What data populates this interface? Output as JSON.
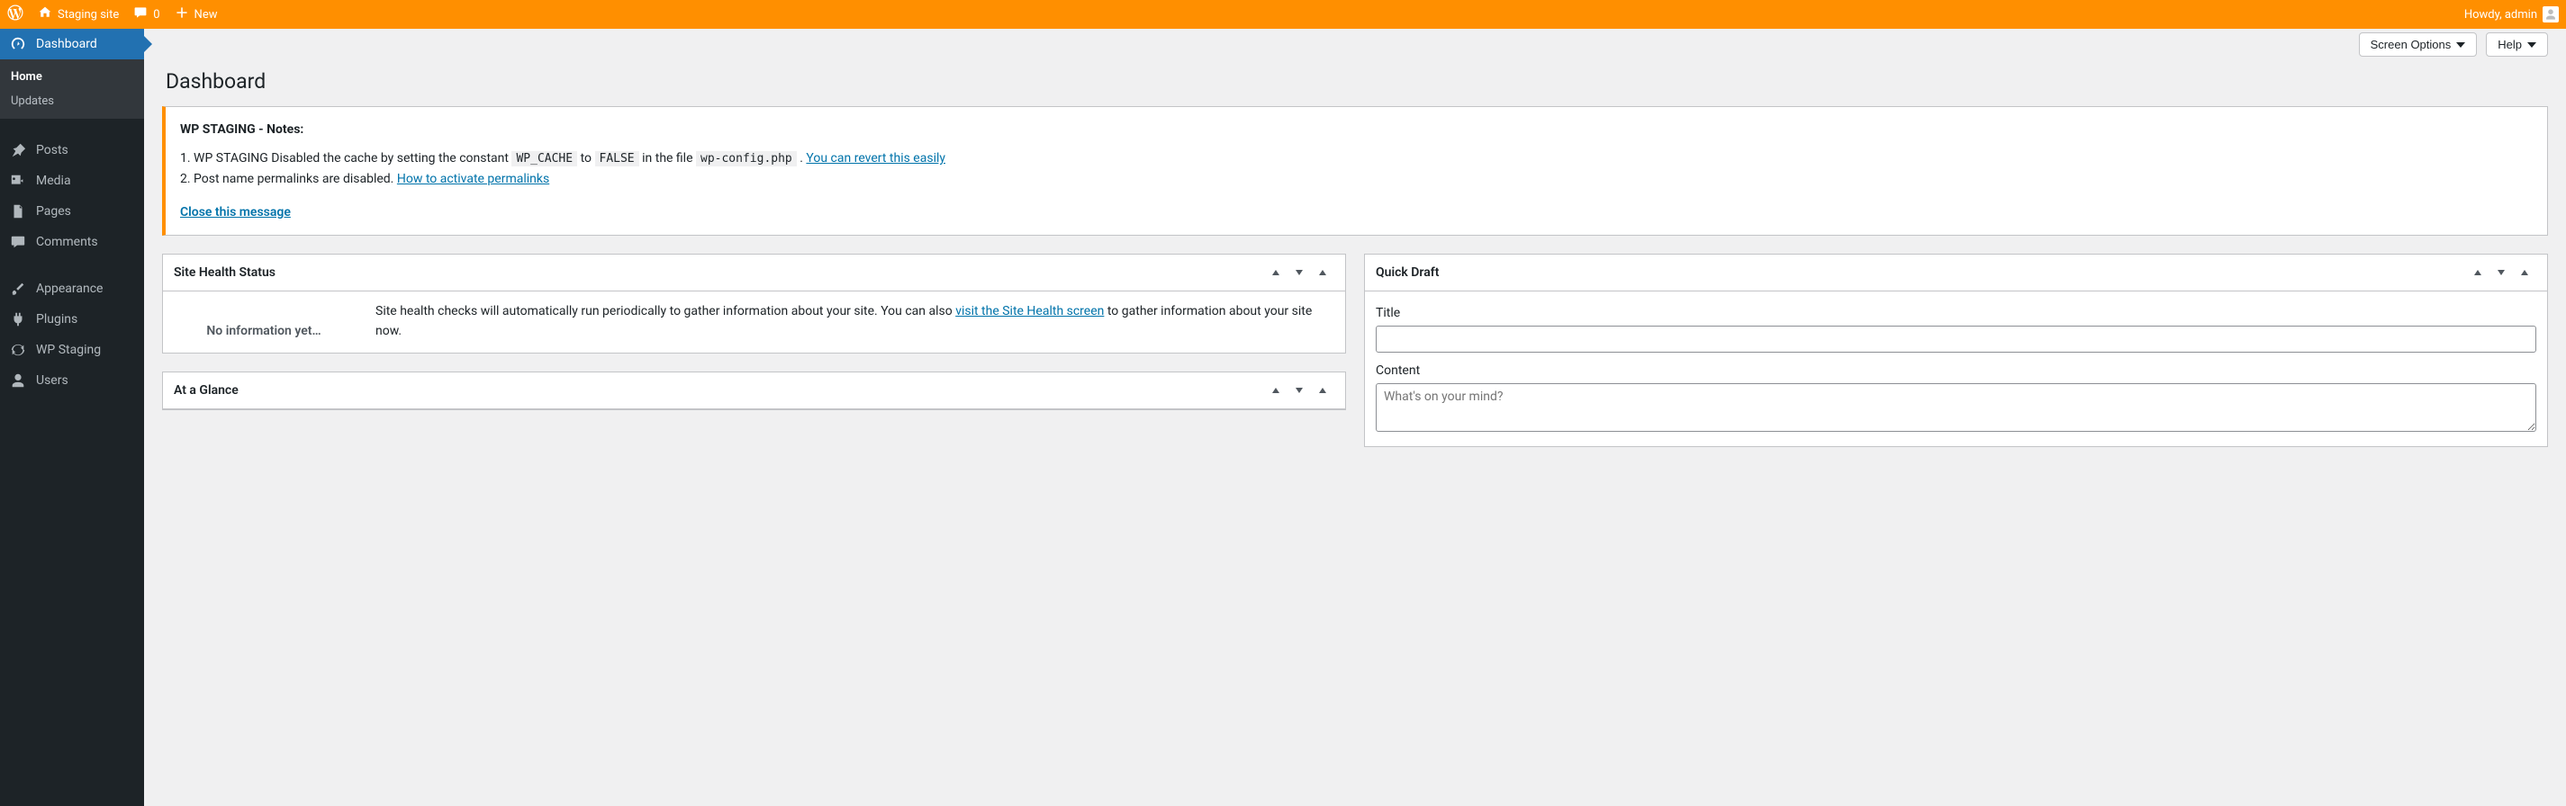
{
  "adminbar": {
    "site_name": "Staging site",
    "comment_count": "0",
    "new_label": "New",
    "howdy": "Howdy, admin"
  },
  "screen_meta": {
    "screen_options": "Screen Options",
    "help": "Help"
  },
  "page": {
    "title": "Dashboard"
  },
  "sidebar": {
    "dashboard": "Dashboard",
    "home": "Home",
    "updates": "Updates",
    "posts": "Posts",
    "media": "Media",
    "pages": "Pages",
    "comments": "Comments",
    "appearance": "Appearance",
    "plugins": "Plugins",
    "wp_staging": "WP Staging",
    "users": "Users"
  },
  "notice": {
    "heading": "WP STAGING - Notes:",
    "item1_a": "WP STAGING Disabled the cache by setting the constant",
    "item1_code1": "WP_CACHE",
    "item1_b": "to",
    "item1_code2": "FALSE",
    "item1_c": "in the file",
    "item1_code3": "wp-config.php",
    "item1_d": ".",
    "item1_link": "You can revert this easily",
    "item2_a": "Post name permalinks are disabled.",
    "item2_link": "How to activate permalinks",
    "close": "Close this message"
  },
  "widgets": {
    "site_health": {
      "title": "Site Health Status",
      "status": "No information yet…",
      "body_a": "Site health checks will automatically run periodically to gather information about your site. You can also ",
      "body_link": "visit the Site Health screen",
      "body_b": " to gather information about your site now."
    },
    "at_a_glance": {
      "title": "At a Glance"
    },
    "quick_draft": {
      "title": "Quick Draft",
      "title_label": "Title",
      "content_label": "Content",
      "content_placeholder": "What's on your mind?"
    }
  }
}
